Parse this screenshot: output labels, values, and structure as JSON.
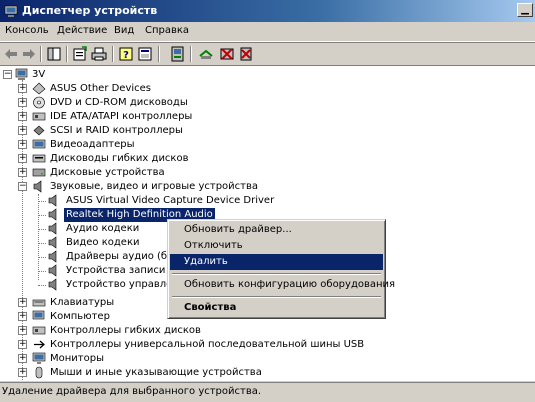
{
  "window": {
    "title": "Диспетчер устройств"
  },
  "menubar": {
    "items": [
      "Консоль",
      "Действие",
      "Вид",
      "Справка"
    ]
  },
  "tree": {
    "root": "3V",
    "items": [
      "ASUS Other Devices",
      "DVD и CD-ROM дисководы",
      "IDE ATA/ATAPI контроллеры",
      "SCSI и RAID контроллеры",
      "Видеоадаптеры",
      "Дисководы гибких дисков",
      "Дисковые устройства",
      "Звуковые, видео и игровые устройства",
      "ASUS Virtual Video Capture Device Driver",
      "Realtek High Definition Audio",
      "Аудио кодеки",
      "Видео кодеки",
      "Драйверы аудио (без",
      "Устройства записи ви",
      "Устройство управлен",
      "Клавиатуры",
      "Компьютер",
      "Контроллеры гибких дисков",
      "Контроллеры универсальной последовательной шины USB",
      "Мониторы",
      "Мыши и иные указывающие устройства"
    ]
  },
  "context_menu": {
    "items": [
      "Обновить драйвер...",
      "Отключить",
      "Удалить",
      "Обновить конфигурацию оборудования",
      "Свойства"
    ]
  },
  "statusbar": {
    "text": "Удаление драйвера для выбранного устройства."
  },
  "colors": {
    "title_start": "#0a246a",
    "selection": "#0a246a",
    "face": "#d4d0c8"
  },
  "icons": [
    "device-manager-icon",
    "back-arrow-icon",
    "forward-arrow-icon",
    "console-tree-icon",
    "properties-icon",
    "print-icon",
    "help-icon",
    "view-icon",
    "update-driver-icon",
    "scan-hardware-icon",
    "disable-device-icon",
    "uninstall-icon"
  ]
}
